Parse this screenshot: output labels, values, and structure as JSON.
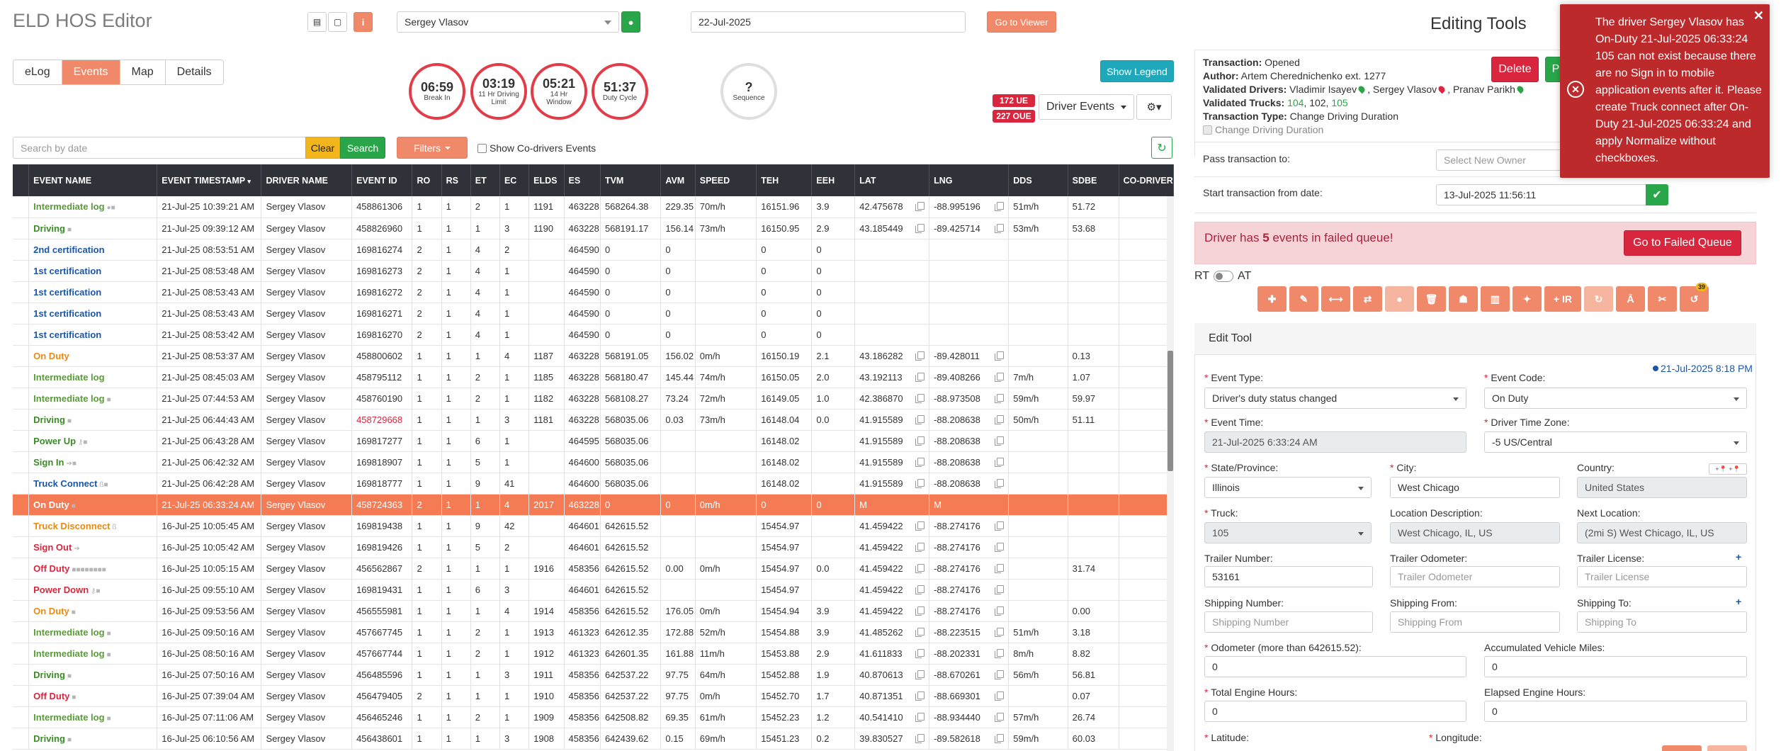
{
  "header": {
    "app_title": "ELD HOS Editor",
    "driver": "Sergey Vlasov",
    "date": "22-Jul-2025",
    "goto_viewer": "Go to Viewer",
    "editing_title": "Editing Tools"
  },
  "tabs": [
    "eLog",
    "Events",
    "Map",
    "Details"
  ],
  "gauges": [
    {
      "value": "06:59",
      "label": "Break In",
      "color": "#e23c48"
    },
    {
      "value": "03:19",
      "label": "11 Hr Driving Limit",
      "color": "#e23c48"
    },
    {
      "value": "05:21",
      "label": "14 Hr Window",
      "color": "#e23c48"
    },
    {
      "value": "51:37",
      "label": "Duty Cycle",
      "color": "#e23c48"
    },
    {
      "value": "?",
      "label": "Sequence",
      "color": "#dedede"
    }
  ],
  "controls": {
    "show_legend": "Show Legend",
    "ue_badge": "172 UE",
    "oue_badge": "227 OUE",
    "driver_events": "Driver Events",
    "search_placeholder": "Search by date",
    "clear": "Clear",
    "search": "Search",
    "filters": "Filters",
    "show_codrivers": "Show Co-drivers Events"
  },
  "table": {
    "columns": [
      "EVENT NAME",
      "EVENT TIMESTAMP",
      "DRIVER NAME",
      "EVENT ID",
      "RO",
      "RS",
      "ET",
      "EC",
      "ELDS",
      "ES",
      "TVM",
      "AVM",
      "SPEED",
      "TEH",
      "EEH",
      "LAT",
      "LNG",
      "DDS",
      "SDBE",
      "CO-DRIVER"
    ],
    "rows": [
      {
        "name": "Intermediate log",
        "cls": "c-green",
        "icons": "●■",
        "ts": "21-Jul-25 10:39:21 AM",
        "driver": "Sergey Vlasov",
        "id": "458861306",
        "ro": "1",
        "rs": "1",
        "et": "2",
        "ec": "1",
        "elds": "1191",
        "es": "463228",
        "tvm": "568264.38",
        "avm": "229.35",
        "speed": "70m/h",
        "teh": "16151.96",
        "eeh": "3.9",
        "lat": "42.475678",
        "lng": "-88.995196",
        "dds": "51m/h",
        "sdbe": "51.72",
        "copy": true
      },
      {
        "name": "Driving",
        "cls": "c-darkgreen",
        "icons": "■",
        "ts": "21-Jul-25 09:39:12 AM",
        "driver": "Sergey Vlasov",
        "id": "458826960",
        "ro": "1",
        "rs": "1",
        "et": "1",
        "ec": "3",
        "elds": "1190",
        "es": "463228",
        "tvm": "568191.17",
        "avm": "156.14",
        "speed": "73m/h",
        "teh": "16150.95",
        "eeh": "2.9",
        "lat": "43.185449",
        "lng": "-89.425714",
        "dds": "53m/h",
        "sdbe": "53.68",
        "copy": true
      },
      {
        "name": "2nd certification",
        "cls": "c-blue",
        "icons": "",
        "ts": "21-Jul-25 08:53:51 AM",
        "driver": "Sergey Vlasov",
        "id": "169816274",
        "ro": "2",
        "rs": "1",
        "et": "4",
        "ec": "2",
        "elds": "",
        "es": "464590",
        "tvm": "0",
        "avm": "0",
        "speed": "",
        "teh": "0",
        "eeh": "0",
        "lat": "",
        "lng": "",
        "dds": "",
        "sdbe": "",
        "copy": false
      },
      {
        "name": "1st certification",
        "cls": "c-blue",
        "icons": "",
        "ts": "21-Jul-25 08:53:48 AM",
        "driver": "Sergey Vlasov",
        "id": "169816273",
        "ro": "2",
        "rs": "1",
        "et": "4",
        "ec": "1",
        "elds": "",
        "es": "464590",
        "tvm": "0",
        "avm": "0",
        "speed": "",
        "teh": "0",
        "eeh": "0",
        "lat": "",
        "lng": "",
        "dds": "",
        "sdbe": "",
        "copy": false
      },
      {
        "name": "1st certification",
        "cls": "c-blue",
        "icons": "",
        "ts": "21-Jul-25 08:53:43 AM",
        "driver": "Sergey Vlasov",
        "id": "169816272",
        "ro": "2",
        "rs": "1",
        "et": "4",
        "ec": "1",
        "elds": "",
        "es": "464590",
        "tvm": "0",
        "avm": "0",
        "speed": "",
        "teh": "0",
        "eeh": "0",
        "lat": "",
        "lng": "",
        "dds": "",
        "sdbe": "",
        "copy": false
      },
      {
        "name": "1st certification",
        "cls": "c-blue",
        "icons": "",
        "ts": "21-Jul-25 08:53:43 AM",
        "driver": "Sergey Vlasov",
        "id": "169816271",
        "ro": "2",
        "rs": "1",
        "et": "4",
        "ec": "1",
        "elds": "",
        "es": "464590",
        "tvm": "0",
        "avm": "0",
        "speed": "",
        "teh": "0",
        "eeh": "0",
        "lat": "",
        "lng": "",
        "dds": "",
        "sdbe": "",
        "copy": false
      },
      {
        "name": "1st certification",
        "cls": "c-blue",
        "icons": "",
        "ts": "21-Jul-25 08:53:42 AM",
        "driver": "Sergey Vlasov",
        "id": "169816270",
        "ro": "2",
        "rs": "1",
        "et": "4",
        "ec": "1",
        "elds": "",
        "es": "464590",
        "tvm": "0",
        "avm": "0",
        "speed": "",
        "teh": "0",
        "eeh": "0",
        "lat": "",
        "lng": "",
        "dds": "",
        "sdbe": "",
        "copy": false
      },
      {
        "name": "On Duty",
        "cls": "c-orange",
        "icons": "",
        "ts": "21-Jul-25 08:53:37 AM",
        "driver": "Sergey Vlasov",
        "id": "458800602",
        "ro": "1",
        "rs": "1",
        "et": "1",
        "ec": "4",
        "elds": "1187",
        "es": "463228",
        "tvm": "568191.05",
        "avm": "156.02",
        "speed": "0m/h",
        "teh": "16150.19",
        "eeh": "2.1",
        "lat": "43.186282",
        "lng": "-89.428011",
        "dds": "",
        "sdbe": "0.13",
        "copy": true
      },
      {
        "name": "Intermediate log",
        "cls": "c-green",
        "icons": "",
        "ts": "21-Jul-25 08:45:03 AM",
        "driver": "Sergey Vlasov",
        "id": "458795112",
        "ro": "1",
        "rs": "1",
        "et": "2",
        "ec": "1",
        "elds": "1185",
        "es": "463228",
        "tvm": "568180.47",
        "avm": "145.44",
        "speed": "74m/h",
        "teh": "16150.05",
        "eeh": "2.0",
        "lat": "43.192113",
        "lng": "-89.408266",
        "dds": "7m/h",
        "sdbe": "1.07",
        "copy": true
      },
      {
        "name": "Intermediate log",
        "cls": "c-green",
        "icons": "■",
        "ts": "21-Jul-25 07:44:53 AM",
        "driver": "Sergey Vlasov",
        "id": "458760190",
        "ro": "1",
        "rs": "1",
        "et": "2",
        "ec": "1",
        "elds": "1182",
        "es": "463228",
        "tvm": "568108.27",
        "avm": "73.24",
        "speed": "72m/h",
        "teh": "16149.05",
        "eeh": "1.0",
        "lat": "42.386870",
        "lng": "-88.973508",
        "dds": "59m/h",
        "sdbe": "59.97",
        "copy": true
      },
      {
        "name": "Driving",
        "cls": "c-darkgreen",
        "icons": "■",
        "ts": "21-Jul-25 06:44:43 AM",
        "driver": "Sergey Vlasov",
        "id": "458729668",
        "idRed": true,
        "ro": "1",
        "rs": "1",
        "et": "1",
        "ec": "3",
        "elds": "1181",
        "es": "463228",
        "tvm": "568035.06",
        "avm": "0.03",
        "speed": "73m/h",
        "teh": "16148.04",
        "eeh": "0.0",
        "lat": "41.915589",
        "lng": "-88.208638",
        "dds": "50m/h",
        "sdbe": "51.11",
        "copy": true
      },
      {
        "name": "Power Up",
        "cls": "c-darkgreen",
        "icons": "⚷■",
        "ts": "21-Jul-25 06:43:28 AM",
        "driver": "Sergey Vlasov",
        "id": "169817277",
        "ro": "1",
        "rs": "1",
        "et": "6",
        "ec": "1",
        "elds": "",
        "es": "464595",
        "tvm": "568035.06",
        "avm": "",
        "speed": "",
        "teh": "16148.02",
        "eeh": "",
        "lat": "41.915589",
        "lng": "-88.208638",
        "dds": "",
        "sdbe": "",
        "copy": true
      },
      {
        "name": "Sign In",
        "cls": "c-darkgreen",
        "icons": "➔■",
        "ts": "21-Jul-25 06:42:32 AM",
        "driver": "Sergey Vlasov",
        "id": "169818907",
        "ro": "1",
        "rs": "1",
        "et": "5",
        "ec": "1",
        "elds": "",
        "es": "464600",
        "tvm": "568035.06",
        "avm": "",
        "speed": "",
        "teh": "16148.02",
        "eeh": "",
        "lat": "41.915589",
        "lng": "-88.208638",
        "dds": "",
        "sdbe": "",
        "copy": true
      },
      {
        "name": "Truck Connect",
        "cls": "c-blue",
        "icons": "ß■",
        "ts": "21-Jul-25 06:42:28 AM",
        "driver": "Sergey Vlasov",
        "id": "169818777",
        "ro": "1",
        "rs": "1",
        "et": "9",
        "ec": "41",
        "elds": "",
        "es": "464600",
        "tvm": "568035.06",
        "avm": "",
        "speed": "",
        "teh": "16148.02",
        "eeh": "",
        "lat": "41.915589",
        "lng": "-88.208638",
        "dds": "",
        "sdbe": "",
        "copy": true
      },
      {
        "name": "On Duty",
        "cls": "c-orange",
        "icons": "■",
        "ts": "21-Jul-25 06:33:24 AM",
        "driver": "Sergey Vlasov",
        "id": "458724363",
        "ro": "2",
        "rs": "1",
        "et": "1",
        "ec": "4",
        "elds": "2017",
        "es": "463228",
        "tvm": "0",
        "avm": "0",
        "speed": "0m/h",
        "teh": "0",
        "eeh": "0",
        "lat": "M",
        "lng": "M",
        "dds": "",
        "sdbe": "",
        "copy": false,
        "selected": true
      },
      {
        "name": "Truck Disconnect",
        "cls": "c-orange",
        "icons": "ß",
        "ts": "16-Jul-25 10:05:45 AM",
        "driver": "Sergey Vlasov",
        "id": "169819438",
        "ro": "1",
        "rs": "1",
        "et": "9",
        "ec": "42",
        "elds": "",
        "es": "464601",
        "tvm": "642615.52",
        "avm": "",
        "speed": "",
        "teh": "15454.97",
        "eeh": "",
        "lat": "41.459422",
        "lng": "-88.274176",
        "dds": "",
        "sdbe": "",
        "copy": true
      },
      {
        "name": "Sign Out",
        "cls": "c-red",
        "icons": "➔",
        "ts": "16-Jul-25 10:05:42 AM",
        "driver": "Sergey Vlasov",
        "id": "169819426",
        "ro": "1",
        "rs": "1",
        "et": "5",
        "ec": "2",
        "elds": "",
        "es": "464601",
        "tvm": "642615.52",
        "avm": "",
        "speed": "",
        "teh": "15454.97",
        "eeh": "",
        "lat": "41.459422",
        "lng": "-88.274176",
        "dds": "",
        "sdbe": "",
        "copy": true
      },
      {
        "name": "Off Duty",
        "cls": "c-red",
        "icons": "■■■■■■■■",
        "ts": "16-Jul-25 10:05:15 AM",
        "driver": "Sergey Vlasov",
        "id": "456562867",
        "ro": "2",
        "rs": "1",
        "et": "1",
        "ec": "1",
        "elds": "1916",
        "es": "458356",
        "tvm": "642615.52",
        "avm": "0.00",
        "speed": "0m/h",
        "teh": "15454.97",
        "eeh": "0.0",
        "lat": "41.459422",
        "lng": "-88.274176",
        "dds": "",
        "sdbe": "31.74",
        "copy": true
      },
      {
        "name": "Power Down",
        "cls": "c-red",
        "icons": "⚷■",
        "ts": "16-Jul-25 09:55:10 AM",
        "driver": "Sergey Vlasov",
        "id": "169819431",
        "ro": "1",
        "rs": "1",
        "et": "6",
        "ec": "3",
        "elds": "",
        "es": "464601",
        "tvm": "642615.52",
        "avm": "",
        "speed": "",
        "teh": "15454.97",
        "eeh": "",
        "lat": "41.459422",
        "lng": "-88.274176",
        "dds": "",
        "sdbe": "",
        "copy": true
      },
      {
        "name": "On Duty",
        "cls": "c-orange",
        "icons": "■",
        "ts": "16-Jul-25 09:53:56 AM",
        "driver": "Sergey Vlasov",
        "id": "456555981",
        "ro": "1",
        "rs": "1",
        "et": "1",
        "ec": "4",
        "elds": "1914",
        "es": "458356",
        "tvm": "642615.52",
        "avm": "176.05",
        "speed": "0m/h",
        "teh": "15454.94",
        "eeh": "3.9",
        "lat": "41.459422",
        "lng": "-88.274176",
        "dds": "",
        "sdbe": "0.00",
        "copy": true
      },
      {
        "name": "Intermediate log",
        "cls": "c-green",
        "icons": "■",
        "ts": "16-Jul-25 09:50:16 AM",
        "driver": "Sergey Vlasov",
        "id": "457667745",
        "ro": "1",
        "rs": "1",
        "et": "2",
        "ec": "1",
        "elds": "1913",
        "es": "461323",
        "tvm": "642612.35",
        "avm": "172.88",
        "speed": "52m/h",
        "teh": "15454.88",
        "eeh": "3.9",
        "lat": "41.485262",
        "lng": "-88.223515",
        "dds": "51m/h",
        "sdbe": "3.18",
        "copy": true
      },
      {
        "name": "Intermediate log",
        "cls": "c-green",
        "icons": "■",
        "ts": "16-Jul-25 08:50:16 AM",
        "driver": "Sergey Vlasov",
        "id": "457667744",
        "ro": "1",
        "rs": "1",
        "et": "2",
        "ec": "1",
        "elds": "1912",
        "es": "461323",
        "tvm": "642601.35",
        "avm": "161.88",
        "speed": "11m/h",
        "teh": "15453.88",
        "eeh": "2.9",
        "lat": "41.611833",
        "lng": "-88.202331",
        "dds": "8m/h",
        "sdbe": "8.82",
        "copy": true
      },
      {
        "name": "Driving",
        "cls": "c-darkgreen",
        "icons": "■",
        "ts": "16-Jul-25 07:50:16 AM",
        "driver": "Sergey Vlasov",
        "id": "456485596",
        "ro": "1",
        "rs": "1",
        "et": "1",
        "ec": "3",
        "elds": "1911",
        "es": "458356",
        "tvm": "642537.22",
        "avm": "97.75",
        "speed": "64m/h",
        "teh": "15452.88",
        "eeh": "1.9",
        "lat": "40.870613",
        "lng": "-88.670261",
        "dds": "56m/h",
        "sdbe": "56.81",
        "copy": true
      },
      {
        "name": "Off Duty",
        "cls": "c-red",
        "icons": "■",
        "ts": "16-Jul-25 07:39:04 AM",
        "driver": "Sergey Vlasov",
        "id": "456479405",
        "ro": "2",
        "rs": "1",
        "et": "1",
        "ec": "1",
        "elds": "1910",
        "es": "458356",
        "tvm": "642537.22",
        "avm": "97.75",
        "speed": "0m/h",
        "teh": "15452.70",
        "eeh": "1.7",
        "lat": "40.871351",
        "lng": "-88.669301",
        "dds": "",
        "sdbe": "0.07",
        "copy": true
      },
      {
        "name": "Intermediate log",
        "cls": "c-green",
        "icons": "■",
        "ts": "16-Jul-25 07:11:06 AM",
        "driver": "Sergey Vlasov",
        "id": "456465246",
        "ro": "1",
        "rs": "1",
        "et": "2",
        "ec": "1",
        "elds": "1909",
        "es": "458356",
        "tvm": "642508.82",
        "avm": "69.35",
        "speed": "61m/h",
        "teh": "15452.23",
        "eeh": "1.2",
        "lat": "40.541410",
        "lng": "-88.934440",
        "dds": "57m/h",
        "sdbe": "26.74",
        "copy": true
      },
      {
        "name": "Driving",
        "cls": "c-darkgreen",
        "icons": "■",
        "ts": "16-Jul-25 06:10:56 AM",
        "driver": "Sergey Vlasov",
        "id": "456438601",
        "ro": "1",
        "rs": "1",
        "et": "1",
        "ec": "3",
        "elds": "1908",
        "es": "458356",
        "tvm": "642439.62",
        "avm": "0.15",
        "speed": "69m/h",
        "teh": "15451.23",
        "eeh": "0.2",
        "lat": "39.830527",
        "lng": "-89.582618",
        "dds": "59m/h",
        "sdbe": "60.03",
        "copy": true
      }
    ]
  },
  "transaction": {
    "transaction_label": "Transaction:",
    "transaction_value": "Opened",
    "author_label": "Author:",
    "author_value": "Artem Cherednichenko ext. 1277",
    "drivers_label": "Validated Drivers:",
    "driver1": "Vladimir Isayev",
    "driver2": "Sergey Vlasov",
    "driver3": "Pranav Parikh",
    "trucks_label": "Validated Trucks:",
    "truck1": "104",
    "truck_sep": ", 102,",
    "truck3": "105",
    "type_label": "Transaction Type:",
    "type_value": "Change Driving Duration",
    "change_duration": "Change Driving Duration",
    "delete": "Delete",
    "save": "P",
    "pass_label": "Pass transaction to:",
    "pass_placeholder": "Select New Owner",
    "start_label": "Start transaction from date:",
    "start_value": "13-Jul-2025 11:56:11"
  },
  "failed": {
    "text_pre": "Driver has ",
    "count": "5",
    "text_post": " events in failed queue!",
    "button": "Go to Failed Queue"
  },
  "rt": "RT",
  "at": "AT",
  "toolbar": [
    {
      "icon": "plus-icon",
      "glyph": "✚",
      "dim": false
    },
    {
      "icon": "pencil-icon",
      "glyph": "✎",
      "dim": false
    },
    {
      "icon": "arrows-h-icon",
      "glyph": "⟷",
      "dim": false
    },
    {
      "icon": "exchange-icon",
      "glyph": "⇄",
      "dim": false
    },
    {
      "icon": "user-icon",
      "glyph": "●",
      "dim": true
    },
    {
      "icon": "trash-icon",
      "glyph": "🗑",
      "dim": false
    },
    {
      "icon": "users-icon",
      "glyph": "☗",
      "dim": false
    },
    {
      "icon": "columns-icon",
      "glyph": "▥",
      "dim": false
    },
    {
      "icon": "magic-icon",
      "glyph": "✦",
      "dim": false
    },
    {
      "icon": "add-ir-icon",
      "glyph": "+ IR",
      "dim": false,
      "wide": true
    },
    {
      "icon": "refresh-icon",
      "glyph": "↻",
      "dim": true
    },
    {
      "icon": "text-height-icon",
      "glyph": "Ā",
      "dim": false
    },
    {
      "icon": "scissors-icon",
      "glyph": "✂",
      "dim": false
    },
    {
      "icon": "history-icon",
      "glyph": "↺",
      "dim": false,
      "badge": "39"
    }
  ],
  "edit_tool": {
    "title": "Edit Tool",
    "timestamp": "21-Jul-2025 8:18 PM",
    "event_type_label": "Event Type:",
    "event_type": "Driver's duty status changed",
    "event_code_label": "Event Code:",
    "event_code": "On Duty",
    "event_time_label": "Event Time:",
    "event_time": "21-Jul-2025 6:33:24 AM",
    "tz_label": "Driver Time Zone:",
    "tz": "-5 US/Central",
    "state_label": "State/Province:",
    "state": "Illinois",
    "city_label": "City:",
    "city": "West Chicago",
    "country_label": "Country:",
    "country": "United States",
    "truck_label": "Truck:",
    "truck": "105",
    "locdesc_label": "Location Description:",
    "locdesc": "West Chicago, IL, US",
    "nextloc_label": "Next Location:",
    "nextloc": "(2mi S) West Chicago, IL, US",
    "trailer_num_label": "Trailer Number:",
    "trailer_num": "53161",
    "trailer_odo_label": "Trailer Odometer:",
    "trailer_odo_ph": "Trailer Odometer",
    "trailer_lic_label": "Trailer License:",
    "trailer_lic_ph": "Trailer License",
    "ship_num_label": "Shipping Number:",
    "ship_num_ph": "Shipping Number",
    "ship_from_label": "Shipping From:",
    "ship_from_ph": "Shipping From",
    "ship_to_label": "Shipping To:",
    "ship_to_ph": "Shipping To",
    "odometer_label": "Odometer (more than 642615.52):",
    "odometer": "0",
    "acc_miles_label": "Accumulated Vehicle Miles:",
    "acc_miles": "0",
    "eng_hours_label": "Total Engine Hours:",
    "eng_hours": "0",
    "elapsed_label": "Elapsed Engine Hours:",
    "elapsed": "0",
    "lat_label": "Latitude:",
    "lng_label": "Longitude:"
  },
  "toast": {
    "message": "The driver Sergey Vlasov has On-Duty 21-Jul-2025 06:33:24 105 can not exist because there are no Sign in to mobile application events after it. Please create Truck connect after On-Duty 21-Jul-2025 06:33:24 and apply Normalize without checkboxes."
  }
}
